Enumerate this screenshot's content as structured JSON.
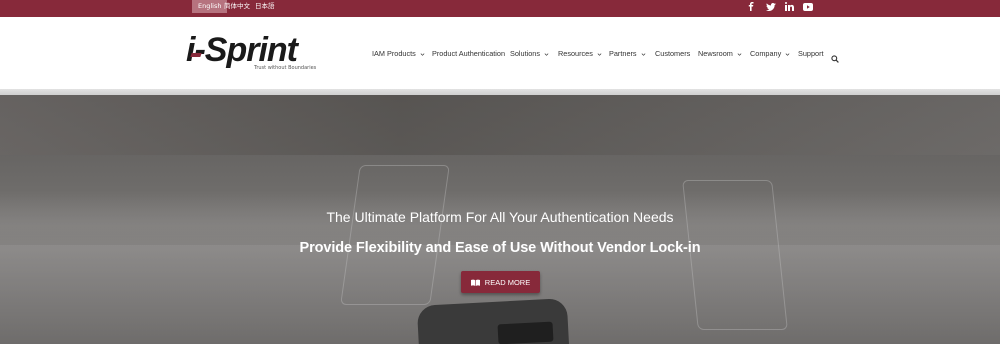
{
  "topbar": {
    "languages": [
      {
        "label": "English",
        "active": true
      },
      {
        "label": "简体中文",
        "active": false
      },
      {
        "label": "日本語",
        "active": false
      }
    ],
    "social": [
      "facebook-icon",
      "twitter-icon",
      "linkedin-icon",
      "youtube-icon"
    ],
    "bg_color": "#87293a"
  },
  "header": {
    "logo_text": "i-Sprint",
    "logo_tagline": "Trust without Boundaries",
    "nav": [
      {
        "label": "IAM Products",
        "dropdown": true
      },
      {
        "label": "Product Authentication",
        "dropdown": false
      },
      {
        "label": "Solutions",
        "dropdown": true
      },
      {
        "label": "Resources",
        "dropdown": true
      },
      {
        "label": "Partners",
        "dropdown": true
      },
      {
        "label": "Customers",
        "dropdown": false
      },
      {
        "label": "Newsroom",
        "dropdown": true
      },
      {
        "label": "Company",
        "dropdown": true
      },
      {
        "label": "Support",
        "dropdown": false
      }
    ]
  },
  "hero": {
    "title": "The Ultimate Platform For All Your Authentication Needs",
    "subtitle": "Provide Flexibility and Ease of Use Without Vendor Lock-in",
    "button_label": "READ MORE",
    "accent_color": "#87293a"
  }
}
